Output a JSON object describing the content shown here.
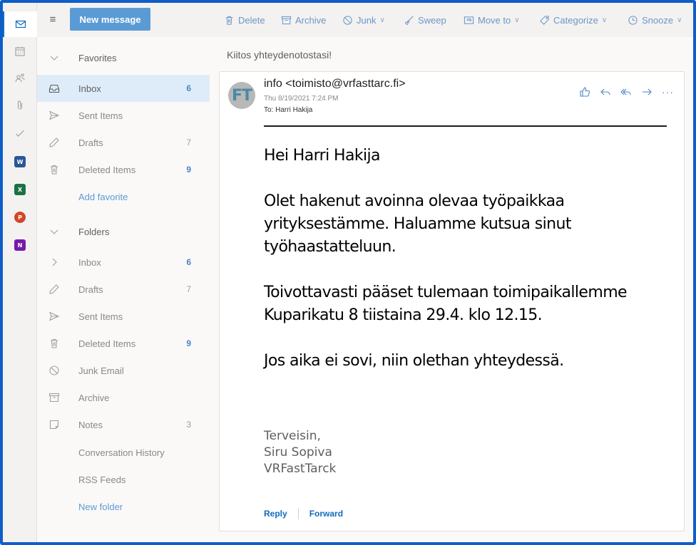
{
  "toolbar": {
    "new_message": "New message",
    "commands": [
      {
        "label": "Delete",
        "icon": "trash-icon"
      },
      {
        "label": "Archive",
        "icon": "archive-icon"
      },
      {
        "label": "Junk",
        "icon": "block-icon"
      },
      {
        "label": "Sweep",
        "icon": "sweep-icon"
      },
      {
        "label": "Move to",
        "icon": "move-icon"
      },
      {
        "label": "Categorize",
        "icon": "tag-icon"
      },
      {
        "label": "Snooze",
        "icon": "clock-icon"
      }
    ]
  },
  "rail": {
    "apps": [
      {
        "name": "mail-icon"
      },
      {
        "name": "calendar-icon"
      },
      {
        "name": "people-icon"
      },
      {
        "name": "attachment-icon"
      },
      {
        "name": "todo-icon"
      },
      {
        "name": "word-icon",
        "letter": "W",
        "color": "#2b5797"
      },
      {
        "name": "excel-icon",
        "letter": "X",
        "color": "#1e7145"
      },
      {
        "name": "powerpoint-icon",
        "letter": "P",
        "color": "#d24726"
      },
      {
        "name": "onenote-icon",
        "letter": "N",
        "color": "#7719aa"
      }
    ]
  },
  "favorites": {
    "header": "Favorites",
    "items": [
      {
        "label": "Inbox",
        "count": "6"
      },
      {
        "label": "Sent Items",
        "count": ""
      },
      {
        "label": "Drafts",
        "count": "7"
      },
      {
        "label": "Deleted Items",
        "count": "9"
      }
    ],
    "add_favorite": "Add favorite"
  },
  "folders": {
    "header": "Folders",
    "items": [
      {
        "label": "Inbox",
        "count": "6"
      },
      {
        "label": "Drafts",
        "count": "7"
      },
      {
        "label": "Sent Items",
        "count": ""
      },
      {
        "label": "Deleted Items",
        "count": "9"
      },
      {
        "label": "Junk Email",
        "count": ""
      },
      {
        "label": "Archive",
        "count": ""
      },
      {
        "label": "Notes",
        "count": "3"
      },
      {
        "label": "Conversation History",
        "count": ""
      },
      {
        "label": "RSS Feeds",
        "count": ""
      }
    ],
    "new_folder": "New folder"
  },
  "message": {
    "subject": "Kiitos yhteydenotostasi!",
    "avatar_initials": "FT",
    "sender": "info <toimisto@vrfasttarc.fi>",
    "date": "Thu 8/19/2021 7:24 PM",
    "to_label": "To:",
    "to": "Harri Hakija",
    "body": {
      "greeting": "Hei Harri Hakija",
      "paragraph1": "Olet hakenut avoinna olevaa työpaikkaa yrityksestämme. Haluamme kutsua sinut työhaastatteluun.",
      "paragraph2": "Toivottavasti pääset tulemaan toimipaikallemme Kuparikatu 8 tiistaina 29.4. klo 12.15.",
      "paragraph3": "Jos aika ei sovi, niin olethan yhteydessä."
    },
    "signature": {
      "line1": "Terveisin,",
      "line2": "Siru Sopiva",
      "line3": "VRFastTarck"
    },
    "reply": "Reply",
    "forward": "Forward"
  },
  "colors": {
    "accent": "#0f6cbd",
    "frame": "#0f5ec8",
    "button": "#5b9bd5"
  }
}
